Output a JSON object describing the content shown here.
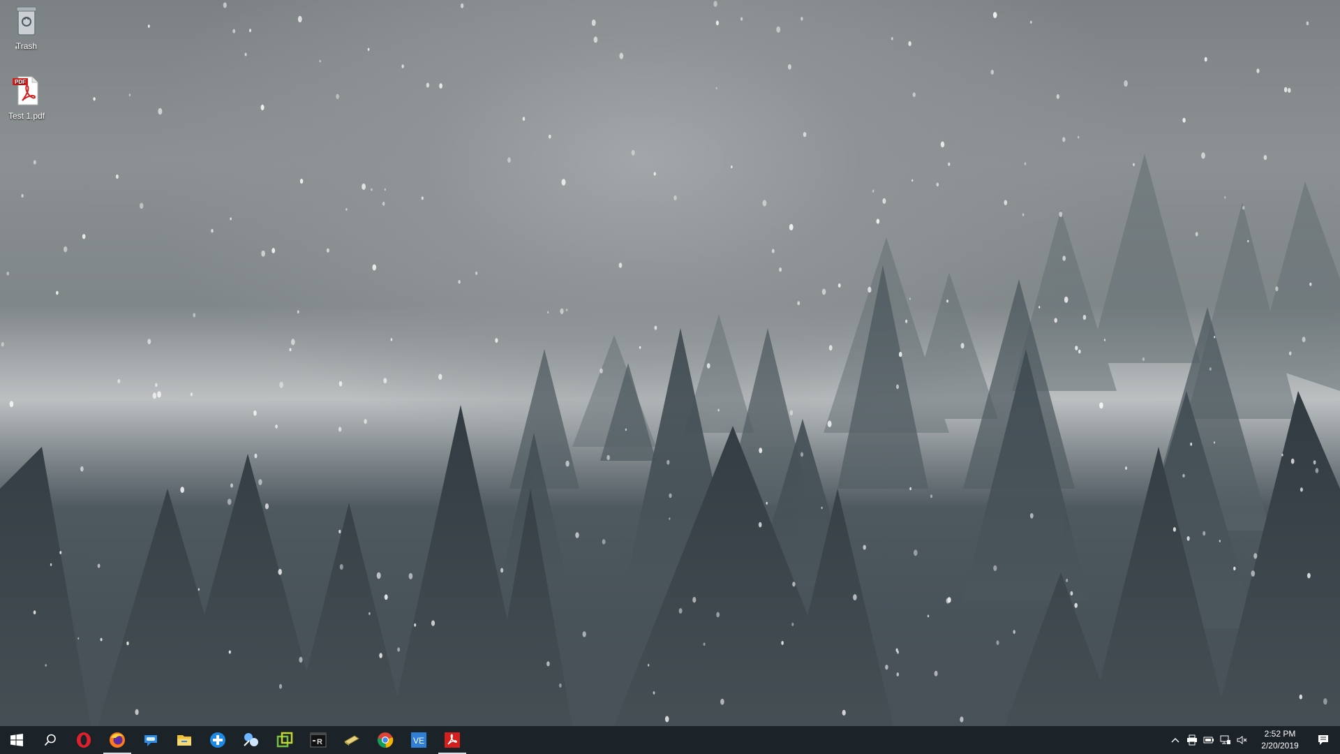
{
  "desktop": {
    "icons": [
      {
        "label": "Trash",
        "icon": "recycle-bin-icon"
      },
      {
        "label": "Test 1.pdf",
        "icon": "pdf-file-icon",
        "badge": "PDF"
      }
    ]
  },
  "taskbar": {
    "start": {
      "icon": "windows-start-icon"
    },
    "search": {
      "icon": "search-icon"
    },
    "apps": [
      {
        "name": "opera-icon",
        "color": "#e0202c",
        "active": false
      },
      {
        "name": "firefox-icon",
        "color": "#ff7a1a",
        "active": true
      },
      {
        "name": "chat-icon",
        "color": "#2e8be6",
        "active": false
      },
      {
        "name": "file-explorer-icon",
        "color": "#f2c037",
        "active": false
      },
      {
        "name": "medical-cross-icon",
        "color": "#1e88e5",
        "active": false
      },
      {
        "name": "network-globe-icon",
        "color": "#6fb6ff",
        "active": false
      },
      {
        "name": "vm-window-icon",
        "color": "#7ac143",
        "active": false
      },
      {
        "name": "r-terminal-icon",
        "color": "#d8d8d8",
        "active": false
      },
      {
        "name": "ticket-icon",
        "color": "#e8d27a",
        "active": false
      },
      {
        "name": "chrome-icon",
        "color": "#34a853",
        "active": false
      },
      {
        "name": "vectorworks-icon",
        "color": "#2f7fd6",
        "label": "VE",
        "active": false
      },
      {
        "name": "acrobat-icon",
        "color": "#d3201f",
        "active": true
      }
    ]
  },
  "tray": {
    "icons": [
      "chevron-up-icon",
      "printer-icon",
      "battery-icon",
      "network-icon",
      "volume-muted-icon"
    ],
    "time": "2:52 PM",
    "date": "2/20/2019",
    "notification_icon": "action-center-icon"
  }
}
